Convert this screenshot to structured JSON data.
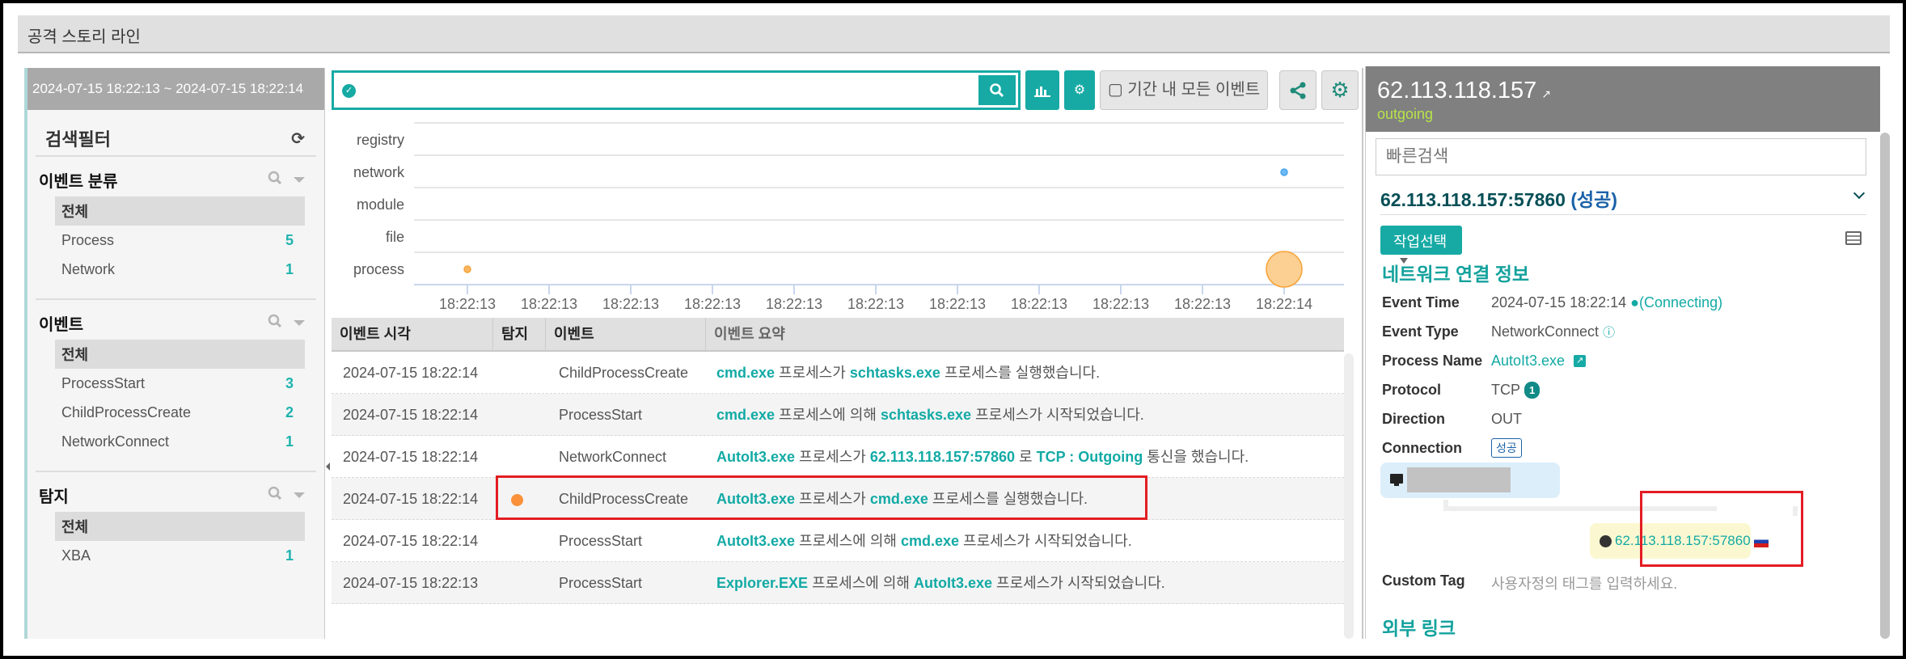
{
  "title": "공격 스토리 라인",
  "left_panel": {
    "date_range": "2024-07-15 18:22:13 ~ 2024-07-15 18:22:14",
    "filter_title": "검색필터",
    "sections": [
      {
        "title": "이벤트 분류",
        "items": [
          {
            "label": "전체",
            "count": "",
            "selected": true
          },
          {
            "label": "Process",
            "count": "5"
          },
          {
            "label": "Network",
            "count": "1"
          }
        ]
      },
      {
        "title": "이벤트",
        "items": [
          {
            "label": "전체",
            "count": "",
            "selected": true
          },
          {
            "label": "ProcessStart",
            "count": "3"
          },
          {
            "label": "ChildProcessCreate",
            "count": "2"
          },
          {
            "label": "NetworkConnect",
            "count": "1"
          }
        ]
      },
      {
        "title": "탐지",
        "items": [
          {
            "label": "전체",
            "count": "",
            "selected": true
          },
          {
            "label": "XBA",
            "count": "1"
          }
        ]
      }
    ]
  },
  "toolbar": {
    "search_value": "",
    "all_events_label": "▢ 기간 내 모든 이벤트"
  },
  "chart_data": {
    "type": "scatter",
    "title": "",
    "categories": [
      "registry",
      "network",
      "module",
      "file",
      "process"
    ],
    "x_tick_labels": [
      "18:22:13",
      "18:22:13",
      "18:22:13",
      "18:22:13",
      "18:22:13",
      "18:22:13",
      "18:22:13",
      "18:22:13",
      "18:22:13",
      "18:22:13",
      "18:22:14"
    ],
    "points": [
      {
        "category": "process",
        "tick_index": 0,
        "count": 1,
        "color": "#f7a43a"
      },
      {
        "category": "network",
        "tick_index": 10,
        "count": 1,
        "color": "#4aa6ef"
      },
      {
        "category": "process",
        "tick_index": 10,
        "count": 4,
        "color": "#f7a43a"
      }
    ],
    "grid": true,
    "legend": "none"
  },
  "table": {
    "headers": [
      "이벤트 시각",
      "탐지",
      "이벤트",
      "이벤트 요약"
    ],
    "rows": [
      {
        "time": "2024-07-15 18:22:14",
        "detect": false,
        "event": "ChildProcessCreate",
        "summary": [
          {
            "t": "cmd.exe",
            "h": true
          },
          {
            "t": " 프로세스가 "
          },
          {
            "t": "schtasks.exe",
            "h": true
          },
          {
            "t": " 프로세스를 실행했습니다."
          }
        ]
      },
      {
        "time": "2024-07-15 18:22:14",
        "detect": false,
        "event": "ProcessStart",
        "summary": [
          {
            "t": "cmd.exe",
            "h": true
          },
          {
            "t": " 프로세스에 의해 "
          },
          {
            "t": "schtasks.exe",
            "h": true
          },
          {
            "t": " 프로세스가 시작되었습니다."
          }
        ]
      },
      {
        "time": "2024-07-15 18:22:14",
        "detect": false,
        "event": "NetworkConnect",
        "summary": [
          {
            "t": "AutoIt3.exe",
            "h": true
          },
          {
            "t": " 프로세스가 "
          },
          {
            "t": "62.113.118.157:57860",
            "h": true
          },
          {
            "t": " 로 "
          },
          {
            "t": "TCP : Outgoing",
            "h": true
          },
          {
            "t": " 통신을 했습니다."
          }
        ]
      },
      {
        "time": "2024-07-15 18:22:14",
        "detect": true,
        "event": "ChildProcessCreate",
        "summary": [
          {
            "t": "AutoIt3.exe",
            "h": true
          },
          {
            "t": " 프로세스가 "
          },
          {
            "t": "cmd.exe",
            "h": true
          },
          {
            "t": " 프로세스를 실행했습니다."
          }
        ]
      },
      {
        "time": "2024-07-15 18:22:14",
        "detect": false,
        "event": "ProcessStart",
        "summary": [
          {
            "t": "AutoIt3.exe",
            "h": true
          },
          {
            "t": " 프로세스에 의해 "
          },
          {
            "t": "cmd.exe",
            "h": true
          },
          {
            "t": " 프로세스가 시작되었습니다."
          }
        ]
      },
      {
        "time": "2024-07-15 18:22:13",
        "detect": false,
        "event": "ProcessStart",
        "summary": [
          {
            "t": "Explorer.EXE",
            "h": true
          },
          {
            "t": " 프로세스에 의해 "
          },
          {
            "t": "AutoIt3.exe",
            "h": true
          },
          {
            "t": " 프로세스가 시작되었습니다."
          }
        ]
      }
    ]
  },
  "right_panel": {
    "ip": "62.113.118.157",
    "direction": "outgoing",
    "quick_search_placeholder": "빠른검색",
    "connection_title": "62.113.118.157:57860",
    "connection_status": "(성공)",
    "action_button": "작업선택",
    "section_title": "네트워크 연결 정보",
    "fields": {
      "event_time_label": "Event Time",
      "event_time": "2024-07-15 18:22:14",
      "event_time_status": "●(Connecting)",
      "event_type_label": "Event Type",
      "event_type": "NetworkConnect",
      "process_name_label": "Process Name",
      "process_name": "AutoIt3.exe",
      "protocol_label": "Protocol",
      "protocol": "TCP",
      "protocol_count": "1",
      "direction_label": "Direction",
      "direction": "OUT",
      "connection_label": "Connection",
      "connection": "성공"
    },
    "remote_endpoint": "62.113.118.157:57860",
    "remote_country_flag": "russia-flag",
    "custom_tag_label": "Custom Tag",
    "custom_tag_placeholder": "사용자정의 태그를 입력하세요.",
    "external_links_title": "외부 링크"
  },
  "colors": {
    "accent": "#17aaa5",
    "highlight_box": "#e31d23",
    "detect_dot": "#fa913a"
  }
}
